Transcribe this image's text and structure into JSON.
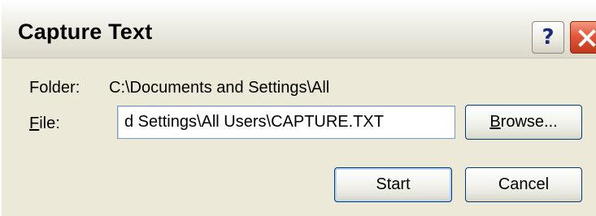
{
  "window": {
    "title": "Capture Text",
    "help_glyph": "?",
    "help_icon": "help-icon",
    "close_icon": "close-icon"
  },
  "form": {
    "folder_label": "Folder:",
    "folder_value": "C:\\Documents and Settings\\All",
    "file_label_mnemonic": "F",
    "file_label_rest": "ile:",
    "file_value": "d Settings\\All Users\\CAPTURE.TXT"
  },
  "buttons": {
    "browse_mnemonic": "B",
    "browse_rest": "rowse...",
    "start_label": "Start",
    "cancel_label": "Cancel"
  },
  "colors": {
    "dialog_bg": "#ece9d8",
    "close_red": "#e3583a",
    "button_border": "#003c74",
    "input_border": "#7f9db9"
  }
}
